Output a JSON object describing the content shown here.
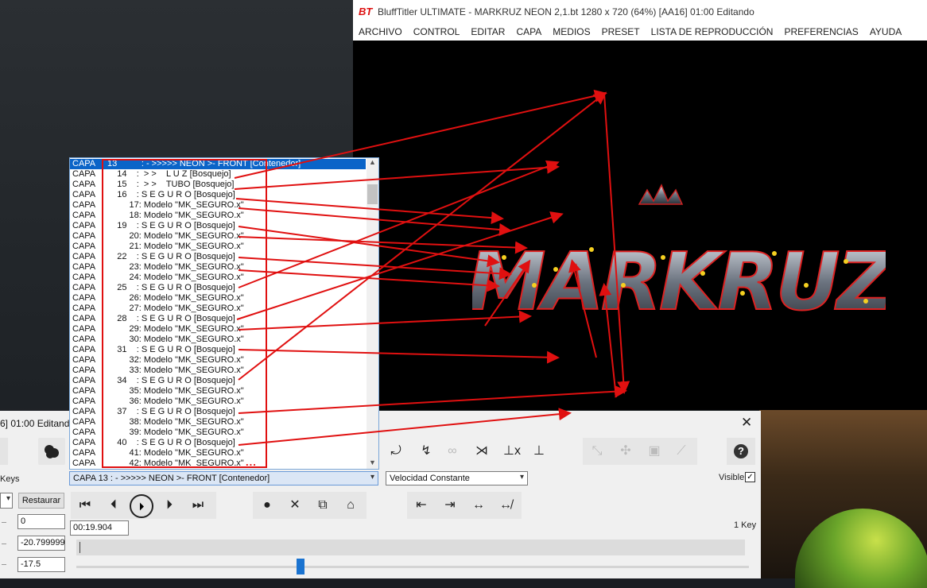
{
  "app": {
    "logo_text": "BT",
    "title": "BluffTitler ULTIMATE  -  MARKRUZ NEON 2,1.bt 1280 x 720 (64%) [AA16] 01:00 Editando",
    "menu": [
      "ARCHIVO",
      "CONTROL",
      "EDITAR",
      "CAPA",
      "MEDIOS",
      "PRESET",
      "LISTA DE REPRODUCCIÓN",
      "PREFERENCIAS",
      "AYUDA"
    ]
  },
  "panel": {
    "title": "6] 01:00 Editando",
    "close_glyph": "✕",
    "keys_label": "Keys",
    "layer_selected": "CAPA      13          : - >>>>> NEON >- FRONT [Contenedor]",
    "speed_selected": "Velocidad Constante",
    "visible_label": "Visible",
    "visible_check": "✓",
    "restore_label": "Restaurar",
    "field1": "0",
    "field2": "-20.799999",
    "field3": "-17.5",
    "time_value": "00:19.904",
    "key_count": "1 Key",
    "help_glyph": "?"
  },
  "layer_list": {
    "rows": [
      {
        "kind": "CAPA",
        "text": " 13          : - >>>>> NEON >- FRONT [Contenedor]",
        "selected": true
      },
      {
        "kind": "CAPA",
        "text": "     14    :  > >    L U Z [Bosquejo]"
      },
      {
        "kind": "CAPA",
        "text": "     15    :  > >    TUBO [Bosquejo]"
      },
      {
        "kind": "CAPA",
        "text": "     16    : S E G U R O [Bosquejo]"
      },
      {
        "kind": "CAPA",
        "text": "          17: Modelo \"MK_SEGURO.x\""
      },
      {
        "kind": "CAPA",
        "text": "          18: Modelo \"MK_SEGURO.x\""
      },
      {
        "kind": "CAPA",
        "text": "     19    : S E G U R O [Bosquejo]"
      },
      {
        "kind": "CAPA",
        "text": "          20: Modelo \"MK_SEGURO.x\""
      },
      {
        "kind": "CAPA",
        "text": "          21: Modelo \"MK_SEGURO.x\""
      },
      {
        "kind": "CAPA",
        "text": "     22    : S E G U R O [Bosquejo]"
      },
      {
        "kind": "CAPA",
        "text": "          23: Modelo \"MK_SEGURO.x\""
      },
      {
        "kind": "CAPA",
        "text": "          24: Modelo \"MK_SEGURO.x\""
      },
      {
        "kind": "CAPA",
        "text": "     25    : S E G U R O [Bosquejo]"
      },
      {
        "kind": "CAPA",
        "text": "          26: Modelo \"MK_SEGURO.x\""
      },
      {
        "kind": "CAPA",
        "text": "          27: Modelo \"MK_SEGURO.x\""
      },
      {
        "kind": "CAPA",
        "text": "     28    : S E G U R O [Bosquejo]"
      },
      {
        "kind": "CAPA",
        "text": "          29: Modelo \"MK_SEGURO.x\""
      },
      {
        "kind": "CAPA",
        "text": "          30: Modelo \"MK_SEGURO.x\""
      },
      {
        "kind": "CAPA",
        "text": "     31    : S E G U R O [Bosquejo]"
      },
      {
        "kind": "CAPA",
        "text": "          32: Modelo \"MK_SEGURO.x\""
      },
      {
        "kind": "CAPA",
        "text": "          33: Modelo \"MK_SEGURO.x\""
      },
      {
        "kind": "CAPA",
        "text": "     34    : S E G U R O [Bosquejo]"
      },
      {
        "kind": "CAPA",
        "text": "          35: Modelo \"MK_SEGURO.x\""
      },
      {
        "kind": "CAPA",
        "text": "          36: Modelo \"MK_SEGURO.x\""
      },
      {
        "kind": "CAPA",
        "text": "     37    : S E G U R O [Bosquejo]"
      },
      {
        "kind": "CAPA",
        "text": "          38: Modelo \"MK_SEGURO.x\""
      },
      {
        "kind": "CAPA",
        "text": "          39: Modelo \"MK_SEGURO.x\""
      },
      {
        "kind": "CAPA",
        "text": "     40    : S E G U R O [Bosquejo]"
      },
      {
        "kind": "CAPA",
        "text": "          41: Modelo \"MK_SEGURO.x\""
      },
      {
        "kind": "CAPA",
        "text": "          42: Modelo \"MK_SEGURO.x\""
      }
    ],
    "ellipsis": "...",
    "scroll_up": "▲",
    "scroll_down": "▼"
  },
  "logo_art_text": "MARKRUZ",
  "colors": {
    "annotation_red": "#e01010",
    "selection_blue": "#0a64c8",
    "brand_red": "#dd1111"
  },
  "icons": {
    "transport": [
      "⏮",
      "⏴",
      "⏵",
      "⏵",
      "⏭"
    ],
    "record": [
      "●",
      "✕",
      "⧉",
      "⌂"
    ],
    "align": [
      "⇤",
      "⇥",
      "↔",
      "↮"
    ],
    "tools": [
      "⤾",
      "↯",
      "∞",
      "⋊",
      "⊥x",
      "⊥"
    ],
    "disabled_tools": [
      "⤡",
      "✣",
      "▣",
      "⟋"
    ]
  }
}
